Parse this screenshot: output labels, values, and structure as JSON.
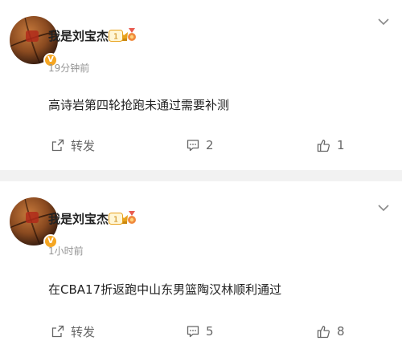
{
  "posts": [
    {
      "author": "我是刘宝杰",
      "level": "1",
      "time": "19分钟前",
      "text": "高诗岩第四轮抢跑未通过需要补测",
      "repost_label": "转发",
      "comment_count": "2",
      "like_count": "1",
      "verified_badge": "V"
    },
    {
      "author": "我是刘宝杰",
      "level": "1",
      "time": "1小时前",
      "text": "在CBA17折返跑中山东男篮陶汉林顺利通过",
      "repost_label": "转发",
      "comment_count": "5",
      "like_count": "8",
      "verified_badge": "V"
    }
  ],
  "colors": {
    "background": "#ffffff",
    "separator": "#f2f2f2",
    "badge_gold": "#f5a623",
    "secondary_text": "#939393"
  },
  "icons": [
    "crown-icon",
    "level-badge-icon",
    "medal-icon",
    "chevron-down-icon",
    "repost-icon",
    "comment-icon",
    "like-icon",
    "verified-icon"
  ]
}
